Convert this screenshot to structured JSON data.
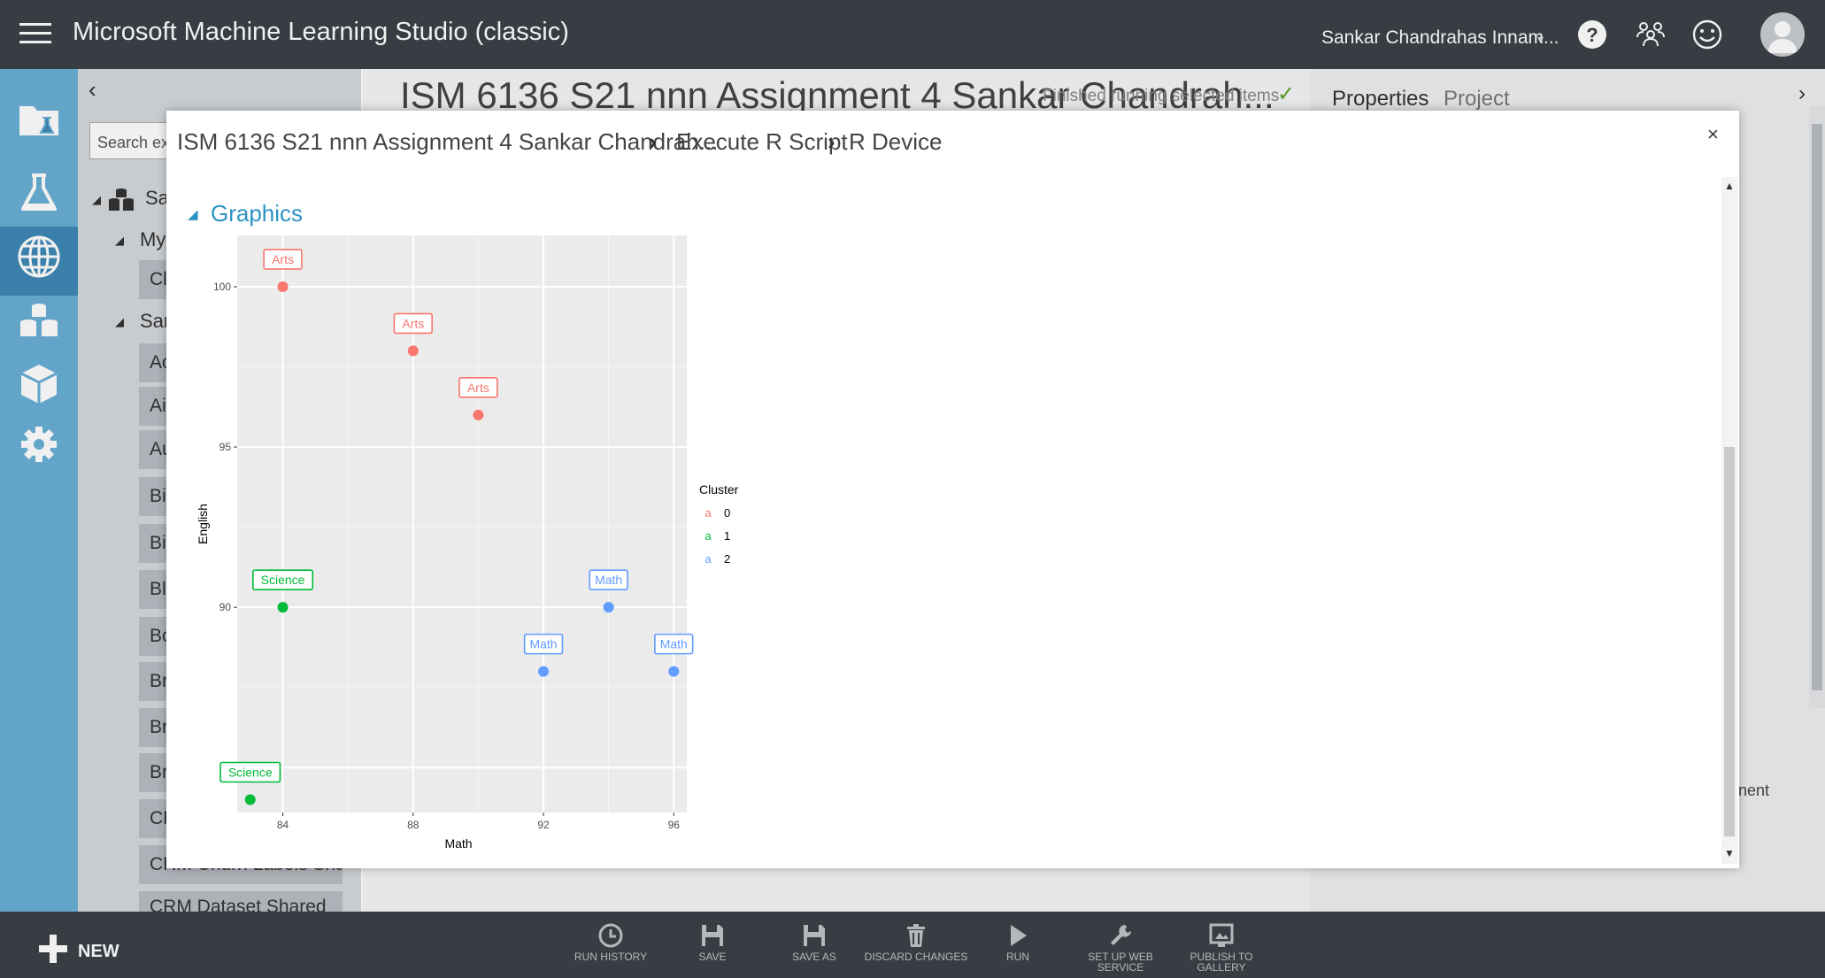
{
  "app": {
    "title": "Microsoft Machine Learning Studio (classic)"
  },
  "user": {
    "name": "Sankar Chandrahas Innam...",
    "caret": "▾"
  },
  "top_icons": [
    "help-icon",
    "people-icon",
    "smiley-feedback-icon",
    "user-avatar-icon"
  ],
  "left_nav": [
    "projects-icon",
    "experiments-icon",
    "web-services-icon",
    "datasets-icon",
    "trained-models-icon",
    "settings-icon"
  ],
  "palette": {
    "collapse": "‹",
    "search_placeholder": "Search ex",
    "tree": [
      {
        "label": "Sa",
        "toggle": "◢"
      },
      {
        "label": "My",
        "toggle": "◢"
      },
      {
        "label": "Sar",
        "toggle": "◢"
      }
    ],
    "items": [
      "Cl",
      "Ac",
      "Ai",
      "Au",
      "Bi",
      "Bi",
      "Bl",
      "Bc",
      "Br",
      "Br",
      "Br",
      "CF",
      "CRM Churn Labels Shar...",
      "CRM Dataset Shared"
    ]
  },
  "experiment": {
    "title": "ISM 6136 S21 nnn Assignment 4 Sankar Chandrah...",
    "status": "Finished running selected items",
    "status_check": "✓"
  },
  "right_panel": {
    "tabs": [
      "Properties",
      "Project"
    ],
    "expand": "›",
    "partial_text": "nent"
  },
  "dialog": {
    "breadcrumb": [
      "ISM 6136 S21 nnn Assignment 4 Sankar Chandrah...",
      "Execute R Script",
      "R Device"
    ],
    "separator": "›",
    "close": "×",
    "section_toggle": "◢",
    "section_title": "Graphics"
  },
  "chart_data": {
    "type": "scatter",
    "title": "",
    "xlabel": "Math",
    "ylabel": "English",
    "xlim": [
      82.6,
      96.4
    ],
    "ylim": [
      83.6,
      101.6
    ],
    "x_ticks": [
      84,
      88,
      92,
      96
    ],
    "y_ticks": [
      85,
      90,
      95,
      100
    ],
    "grid": true,
    "legend": {
      "title": "Cluster",
      "position": "right",
      "entries": [
        "0",
        "1",
        "2"
      ],
      "glyph": "a"
    },
    "colors": {
      "0": "#f8766d",
      "1": "#00ba38",
      "2": "#619cff"
    },
    "points": [
      {
        "x": 84,
        "y": 100,
        "cluster": "0",
        "label": "Arts"
      },
      {
        "x": 88,
        "y": 98,
        "cluster": "0",
        "label": "Arts"
      },
      {
        "x": 90,
        "y": 96,
        "cluster": "0",
        "label": "Arts"
      },
      {
        "x": 84,
        "y": 90,
        "cluster": "1",
        "label": "Science"
      },
      {
        "x": 83,
        "y": 84,
        "cluster": "1",
        "label": "Science"
      },
      {
        "x": 94,
        "y": 90,
        "cluster": "2",
        "label": "Math"
      },
      {
        "x": 92,
        "y": 88,
        "cluster": "2",
        "label": "Math"
      },
      {
        "x": 96,
        "y": 88,
        "cluster": "2",
        "label": "Math"
      }
    ]
  },
  "bottom_bar": {
    "new_label": "NEW",
    "tools": [
      {
        "label": "RUN HISTORY",
        "icon": "history-icon"
      },
      {
        "label": "SAVE",
        "icon": "save-icon"
      },
      {
        "label": "SAVE AS",
        "icon": "save-as-icon"
      },
      {
        "label": "DISCARD CHANGES",
        "icon": "trash-icon"
      },
      {
        "label": "RUN",
        "icon": "run-icon"
      },
      {
        "label": "SET UP WEB SERVICE",
        "icon": "web-service-icon"
      },
      {
        "label": "PUBLISH TO GALLERY",
        "icon": "publish-icon"
      }
    ]
  }
}
